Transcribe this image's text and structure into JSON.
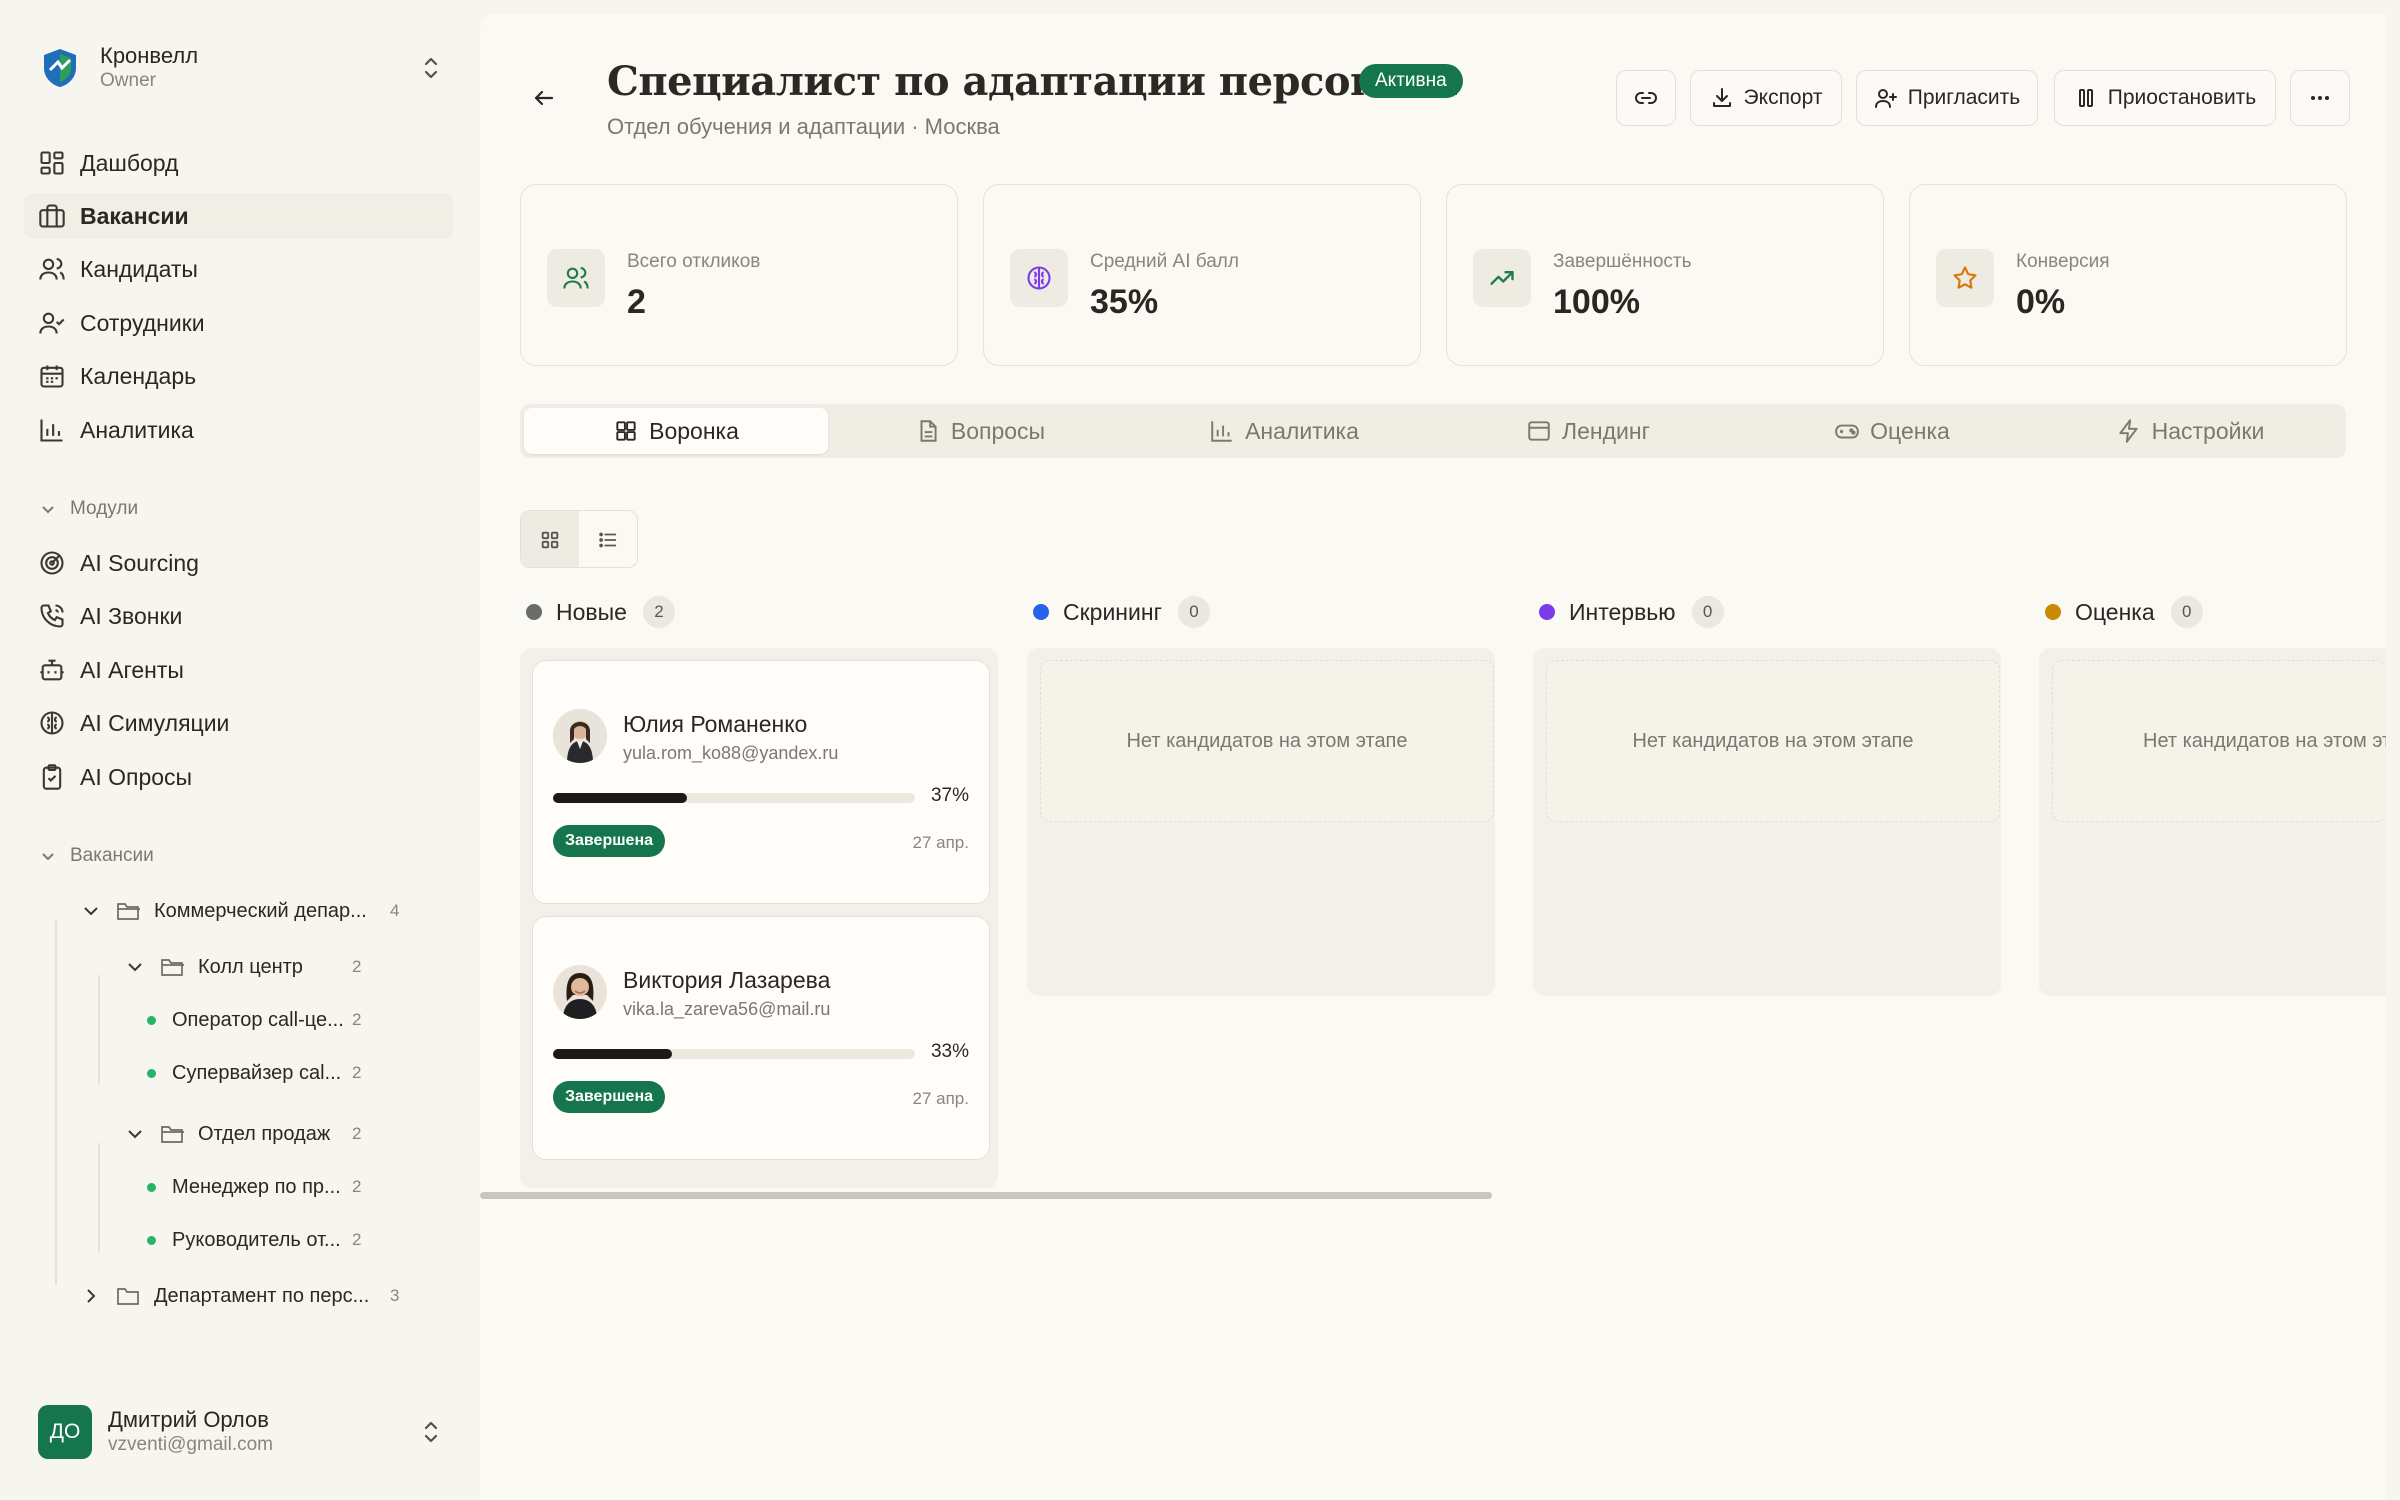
{
  "org": {
    "name": "Кронвелл",
    "role": "Owner"
  },
  "nav": [
    {
      "label": "Дашборд",
      "icon": "dashboard-icon"
    },
    {
      "label": "Вакансии",
      "icon": "briefcase-icon"
    },
    {
      "label": "Кандидаты",
      "icon": "users-icon"
    },
    {
      "label": "Сотрудники",
      "icon": "user-check-icon"
    },
    {
      "label": "Календарь",
      "icon": "calendar-icon"
    },
    {
      "label": "Аналитика",
      "icon": "bar-chart-icon"
    }
  ],
  "modules": {
    "title": "Модули",
    "items": [
      {
        "label": "AI Sourcing",
        "icon": "radar-icon"
      },
      {
        "label": "AI Звонки",
        "icon": "phone-icon"
      },
      {
        "label": "AI Агенты",
        "icon": "bot-icon"
      },
      {
        "label": "AI Симуляции",
        "icon": "brain-icon"
      },
      {
        "label": "AI Опросы",
        "icon": "clipboard-check-icon"
      }
    ]
  },
  "vacancies_tree": {
    "title": "Вакансии",
    "dept1": {
      "label": "Коммерческий депар...",
      "count": "4"
    },
    "callcenter": {
      "label": "Колл центр",
      "count": "2"
    },
    "cc_items": [
      {
        "label": "Оператор call-це...",
        "count": "2"
      },
      {
        "label": "Супервайзер cal...",
        "count": "2"
      }
    ],
    "sales": {
      "label": "Отдел продаж",
      "count": "2"
    },
    "sales_items": [
      {
        "label": "Менеджер по пр...",
        "count": "2"
      },
      {
        "label": "Руководитель от...",
        "count": "2"
      }
    ],
    "dept2": {
      "label": "Департамент по перс...",
      "count": "3"
    }
  },
  "user": {
    "initials": "ДО",
    "name": "Дмитрий Орлов",
    "email": "vzventi@gmail.com"
  },
  "header": {
    "title": "Специалист по адаптации персонала",
    "status": "Активна",
    "subtitle": "Отдел обучения и адаптации · Москва",
    "export_label": "Экспорт",
    "invite_label": "Пригласить",
    "pause_label": "Приостановить"
  },
  "stats": [
    {
      "label": "Всего откликов",
      "value": "2",
      "icon": "users-icon",
      "color": "#1f7a4f"
    },
    {
      "label": "Средний AI балл",
      "value": "35%",
      "icon": "brain-icon",
      "color": "#7c3aed"
    },
    {
      "label": "Завершённость",
      "value": "100%",
      "icon": "trending-up-icon",
      "color": "#1f7a4f"
    },
    {
      "label": "Конверсия",
      "value": "0%",
      "icon": "star-icon",
      "color": "#d97706"
    }
  ],
  "tabs": [
    {
      "label": "Воронка",
      "icon": "grid-icon"
    },
    {
      "label": "Вопросы",
      "icon": "file-text-icon"
    },
    {
      "label": "Аналитика",
      "icon": "bar-chart-icon"
    },
    {
      "label": "Лендинг",
      "icon": "layout-icon"
    },
    {
      "label": "Оценка",
      "icon": "gamepad-icon"
    },
    {
      "label": "Настройки",
      "icon": "zap-icon"
    }
  ],
  "columns": [
    {
      "title": "Новые",
      "count": "2",
      "color": "#6b6b6b"
    },
    {
      "title": "Скрининг",
      "count": "0",
      "color": "#2563eb"
    },
    {
      "title": "Интервью",
      "count": "0",
      "color": "#7c3aed"
    },
    {
      "title": "Оценка",
      "count": "0",
      "color": "#ca8a04"
    }
  ],
  "empty_text": "Нет кандидатов на этом этапе",
  "candidates": [
    {
      "name": "Юлия Романенко",
      "email": "yula.rom_ko88@yandex.ru",
      "score": 0.37,
      "score_label": "37%",
      "status": "Завершена",
      "date": "27 апр."
    },
    {
      "name": "Виктория Лазарева",
      "email": "vika.la_zareva56@mail.ru",
      "score": 0.33,
      "score_label": "33%",
      "status": "Завершена",
      "date": "27 апр."
    }
  ]
}
